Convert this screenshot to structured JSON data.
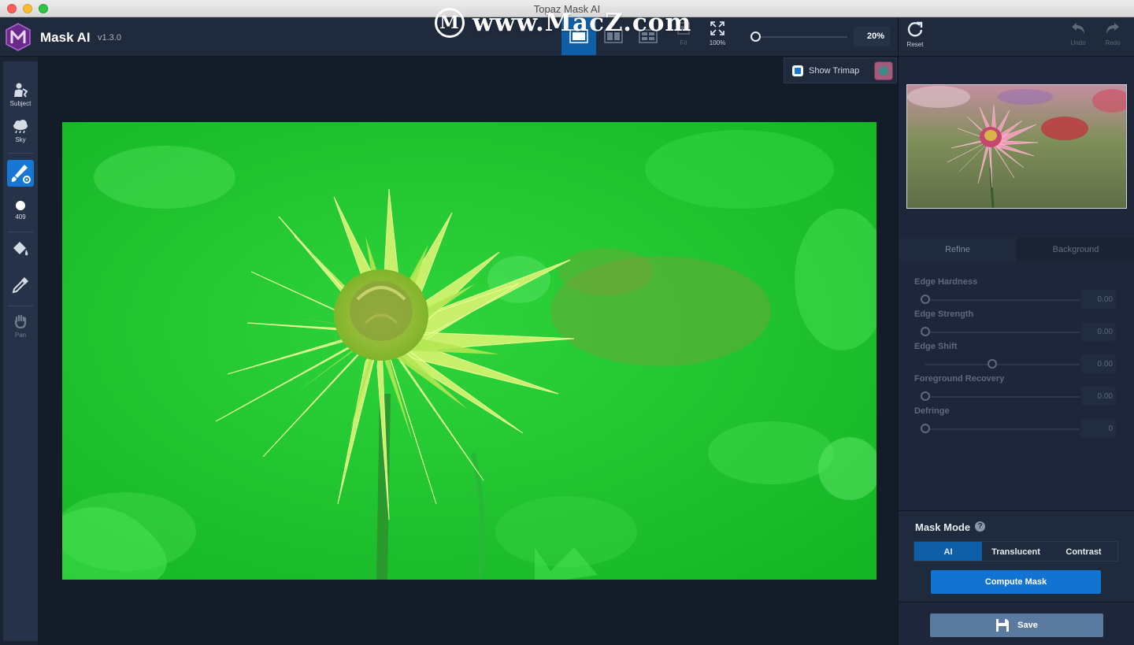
{
  "window": {
    "title": "Topaz Mask AI"
  },
  "watermark": {
    "text": "www.MacZ.com",
    "logo_letter": "M"
  },
  "app": {
    "name": "Mask AI",
    "version": "v1.3.0"
  },
  "toolbar": {
    "fit_label": "Fit",
    "full_label": "100%",
    "zoom_value": "20%",
    "zoom_level": 0.2,
    "reset_label": "Reset",
    "undo_label": "Undo",
    "redo_label": "Redo"
  },
  "left_tools": {
    "subject_label": "Subject",
    "sky_label": "Sky",
    "brush_size": "409",
    "pan_label": "Pan"
  },
  "trimap": {
    "label": "Show Trimap",
    "checked": true
  },
  "right_panel": {
    "tabs": [
      "Refine",
      "Background"
    ],
    "refine": [
      {
        "label": "Edge Hardness",
        "value": "0.00"
      },
      {
        "label": "Edge Strength",
        "value": "0.00"
      },
      {
        "label": "Edge Shift",
        "value": "0.00"
      },
      {
        "label": "Foreground Recovery",
        "value": "0.00"
      },
      {
        "label": "Defringe",
        "value": "0"
      }
    ],
    "mask_mode": {
      "title": "Mask Mode",
      "help": "?",
      "options": [
        "AI",
        "Translucent",
        "Contrast"
      ],
      "selected": "AI",
      "compute_label": "Compute Mask"
    },
    "save_label": "Save"
  },
  "colors": {
    "accent": "#1576d4",
    "active_tab": "#0f5fa8",
    "mask_overlay": "#1fd62b"
  },
  "icons": [
    "app-logo-icon",
    "single-view-icon",
    "split-view-icon",
    "quad-view-icon",
    "fit-icon",
    "fullscreen-icon",
    "reset-icon",
    "undo-icon",
    "redo-icon",
    "subject-icon",
    "sky-icon",
    "brush-settings-icon",
    "brush-size-icon",
    "fill-bucket-icon",
    "eyedropper-icon",
    "pan-hand-icon",
    "save-disk-icon"
  ]
}
